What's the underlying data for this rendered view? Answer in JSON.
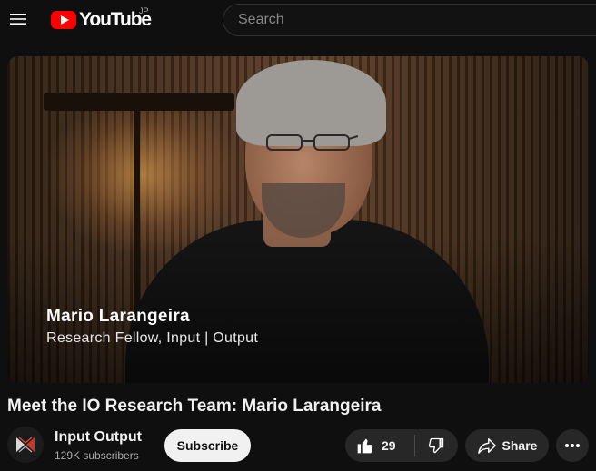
{
  "header": {
    "logo_text": "YouTube",
    "region": "JP",
    "search_placeholder": "Search"
  },
  "video": {
    "lower_third_name": "Mario Larangeira",
    "lower_third_role": "Research Fellow, Input | Output"
  },
  "title": "Meet the IO Research Team: Mario Larangeira",
  "channel": {
    "name": "Input Output",
    "subscribers": "129K subscribers",
    "subscribe_label": "Subscribe"
  },
  "actions": {
    "like_count": "29",
    "share_label": "Share"
  },
  "colors": {
    "background": "#0f0f0f",
    "brand_red": "#ff0000",
    "button_bg": "#272727",
    "subscribe_bg": "#f1f1f1"
  },
  "icons": [
    "menu-icon",
    "youtube-logo-icon",
    "thumbs-up-icon",
    "thumbs-down-icon",
    "share-icon",
    "more-icon",
    "channel-logo-icon"
  ]
}
